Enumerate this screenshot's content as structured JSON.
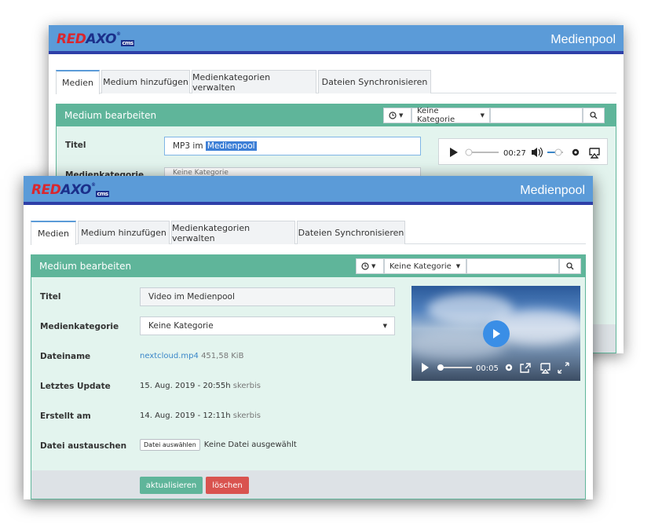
{
  "back_window": {
    "logo": {
      "red": "RED",
      "blue": "AXO",
      "sup": "®",
      "cms": "cms"
    },
    "title": "Medienpool",
    "tabs": [
      "Medien",
      "Medium hinzufügen",
      "Medienkategorien verwalten",
      "Dateien Synchronisieren"
    ],
    "panel_title": "Medium bearbeiten",
    "history_icon": "clock-icon",
    "category_select": "Keine Kategorie",
    "search_icon": "search-icon",
    "title_label": "Titel",
    "title_value_plain": "MP3 im",
    "title_value_selected": "Medienpool",
    "category_label_partial": "Medienkategorie",
    "category_value_partial": "Keine Kategorie",
    "audio_player": {
      "time": "00:27",
      "volume_level": 0.55,
      "progress": 0.02
    }
  },
  "front_window": {
    "logo": {
      "red": "RED",
      "blue": "AXO",
      "sup": "®",
      "cms": "cms"
    },
    "title": "Medienpool",
    "tabs": [
      "Medien",
      "Medium hinzufügen",
      "Medienkategorien verwalten",
      "Dateien Synchronisieren"
    ],
    "panel_title": "Medium bearbeiten",
    "history_icon": "clock-icon",
    "category_select": "Keine Kategorie",
    "search_icon": "search-icon",
    "fields": {
      "titel_label": "Titel",
      "titel_value": "Video im Medienpool",
      "kategorie_label": "Medienkategorie",
      "kategorie_value": "Keine Kategorie",
      "dateiname_label": "Dateiname",
      "dateiname_link": "nextcloud.mp4",
      "dateiname_size": "451,58 KiB",
      "update_label": "Letztes Update",
      "update_date": "15. Aug. 2019 - 20:55h",
      "update_user": "skerbis",
      "erstellt_label": "Erstellt am",
      "erstellt_date": "14. Aug. 2019 - 12:11h",
      "erstellt_user": "skerbis",
      "austauschen_label": "Datei austauschen",
      "file_button": "Datei auswählen",
      "file_status": "Keine Datei ausgewählt"
    },
    "video_player": {
      "time": "00:05",
      "progress": 0.05
    },
    "buttons": {
      "update": "aktualisieren",
      "delete": "löschen"
    },
    "colors": {
      "update": "#5fb59a",
      "delete": "#d9534f"
    }
  }
}
